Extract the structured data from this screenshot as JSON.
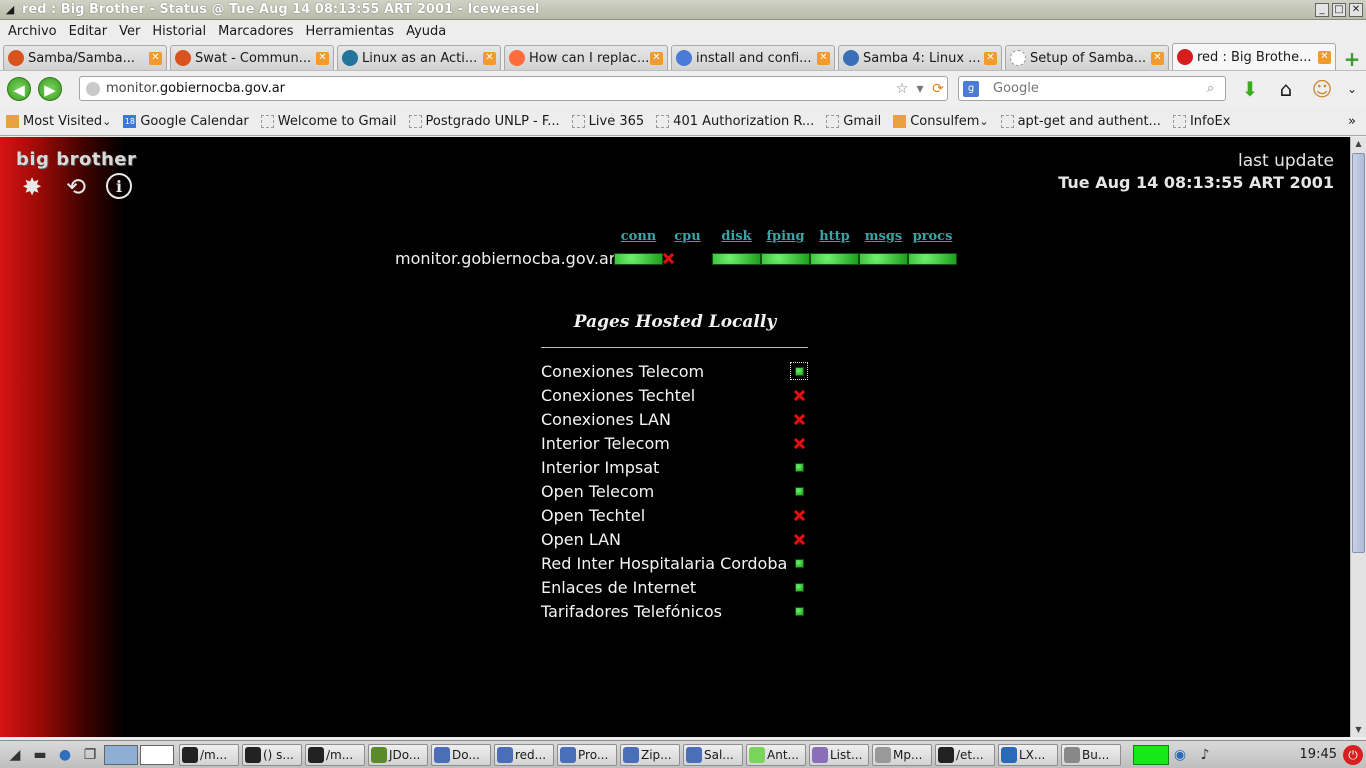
{
  "window": {
    "title": "red : Big Brother - Status @ Tue Aug 14 08:13:55 ART 2001 - Iceweasel"
  },
  "menu": [
    "Archivo",
    "Editar",
    "Ver",
    "Historial",
    "Marcadores",
    "Herramientas",
    "Ayuda"
  ],
  "tabs": [
    {
      "label": "Samba/Samba...",
      "icon_color": "#d9531e"
    },
    {
      "label": "Swat - Commun...",
      "icon_color": "#d9531e"
    },
    {
      "label": "Linux as an Acti...",
      "icon_color": "#21759b"
    },
    {
      "label": "How can I replac...",
      "icon_color": "#ff6b3a"
    },
    {
      "label": "install and confi...",
      "icon_color": "#4a7bd6"
    },
    {
      "label": "Samba 4: Linux ...",
      "icon_color": "#3a6fb8"
    },
    {
      "label": "Setup of Samba...",
      "icon_color": "#ffffff"
    },
    {
      "label": "red : Big Brothe...",
      "icon_color": "#d61c1c",
      "active": true
    }
  ],
  "nav": {
    "url_host_prefix": "monitor.",
    "url_host_main": "gobiernocba.gov.ar",
    "search_placeholder": "Google"
  },
  "bookmarks": [
    {
      "label": "Most Visited",
      "icon": "folder"
    },
    {
      "label": "Google Calendar",
      "icon": "solid"
    },
    {
      "label": "Welcome to Gmail",
      "icon": "blank"
    },
    {
      "label": "Postgrado UNLP - F...",
      "icon": "blank"
    },
    {
      "label": "Live 365",
      "icon": "blank"
    },
    {
      "label": "401 Authorization R...",
      "icon": "blank"
    },
    {
      "label": "Gmail",
      "icon": "blank"
    },
    {
      "label": "Consulfem",
      "icon": "folder"
    },
    {
      "label": "apt-get and authent...",
      "icon": "blank"
    },
    {
      "label": "InfoEx",
      "icon": "blank"
    }
  ],
  "page": {
    "logo": "big brother",
    "last_update_label": "last update",
    "last_update_value": "Tue Aug 14 08:13:55 ART 2001",
    "host": "monitor.gobiernocba.gov.ar",
    "services": [
      {
        "name": "conn",
        "status": "green"
      },
      {
        "name": "cpu",
        "status": "red"
      },
      {
        "name": "disk",
        "status": "green"
      },
      {
        "name": "fping",
        "status": "green"
      },
      {
        "name": "http",
        "status": "green"
      },
      {
        "name": "msgs",
        "status": "green"
      },
      {
        "name": "procs",
        "status": "green"
      }
    ],
    "hosted_title": "Pages Hosted Locally",
    "hosted": [
      {
        "name": "Conexiones Telecom",
        "status": "green",
        "selected": true
      },
      {
        "name": "Conexiones Techtel",
        "status": "red"
      },
      {
        "name": "Conexiones LAN",
        "status": "red"
      },
      {
        "name": "Interior Telecom",
        "status": "red"
      },
      {
        "name": "Interior Impsat",
        "status": "green"
      },
      {
        "name": "Open Telecom",
        "status": "green"
      },
      {
        "name": "Open Techtel",
        "status": "red"
      },
      {
        "name": "Open LAN",
        "status": "red"
      },
      {
        "name": "Red Inter Hospitalaria Cordoba",
        "status": "green"
      },
      {
        "name": "Enlaces de Internet",
        "status": "green"
      },
      {
        "name": "Tarifadores Telefónicos",
        "status": "green"
      }
    ]
  },
  "taskbar": {
    "tasks": [
      "/m...",
      "() s...",
      "/m...",
      "JDo...",
      "Do...",
      "red...",
      "Pro...",
      "Zip...",
      "Sal...",
      "Ant...",
      "List...",
      "Mp...",
      "/et...",
      "LX...",
      "Bu..."
    ],
    "clock": "19:45"
  }
}
